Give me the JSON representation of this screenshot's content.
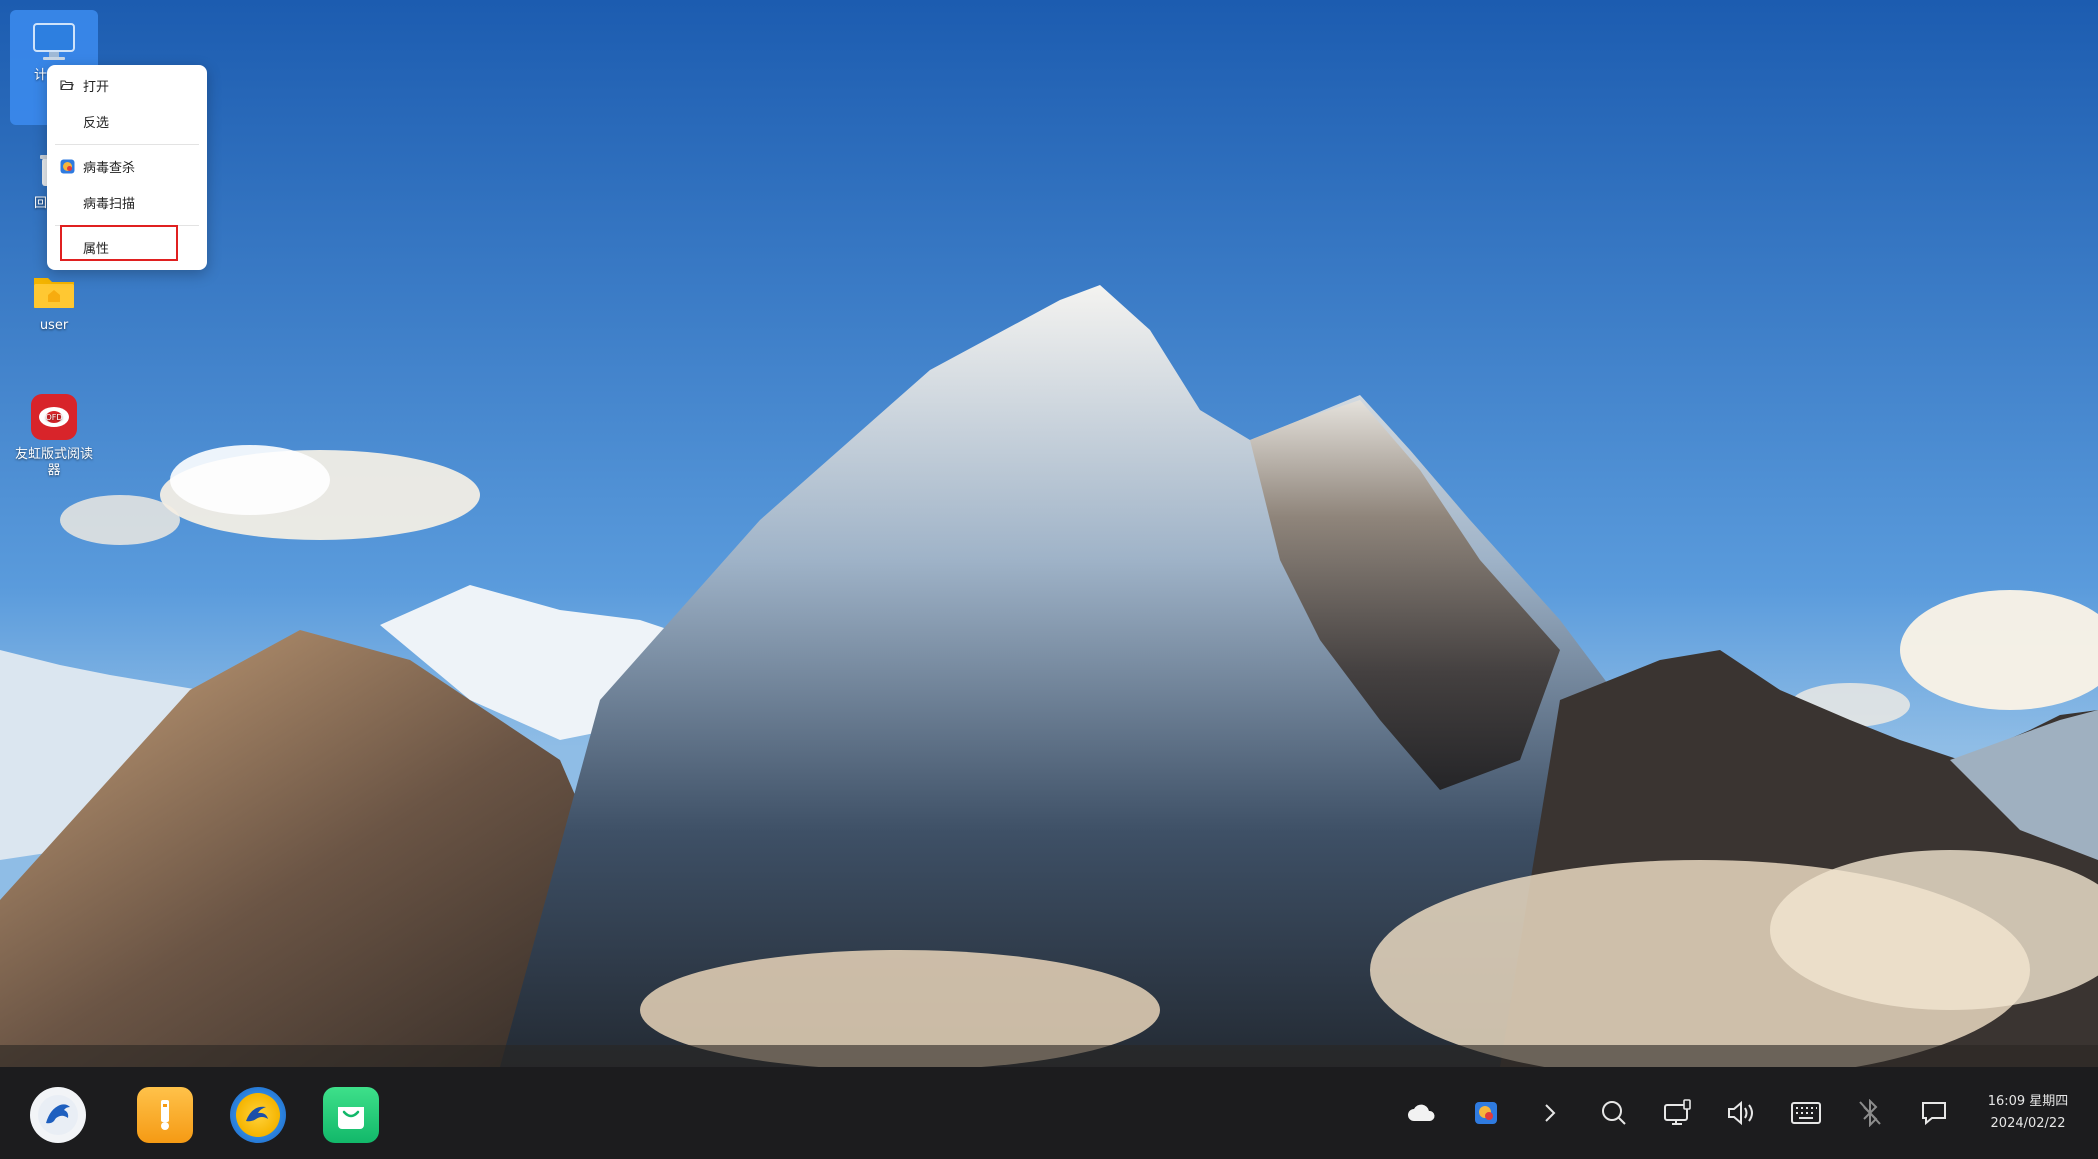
{
  "desktop": {
    "icons": [
      {
        "label": "计",
        "icon": "computer-icon"
      },
      {
        "label": "回",
        "icon": "recycle-bin-icon"
      },
      {
        "label": "user",
        "icon": "home-folder-icon"
      },
      {
        "label": "友虹版式阅读器",
        "icon": "ofd-reader-icon"
      }
    ]
  },
  "context_menu": {
    "items": [
      {
        "label": "打开",
        "icon": "folder-open-icon"
      },
      {
        "label": "反选",
        "icon": ""
      },
      {
        "label": "病毒查杀",
        "icon": "antivirus-icon"
      },
      {
        "label": "病毒扫描",
        "icon": ""
      },
      {
        "label": "属性",
        "icon": ""
      }
    ],
    "highlight_color": "#e02020"
  },
  "taskbar": {
    "apps": [
      {
        "name": "start-menu",
        "icon": "kylin-logo-icon"
      },
      {
        "name": "file-transfer",
        "icon": "usb-app-icon"
      },
      {
        "name": "browser",
        "icon": "browser-icon"
      },
      {
        "name": "app-store",
        "icon": "app-store-icon"
      }
    ],
    "tray": [
      "cloud-icon",
      "security-center-icon",
      "chevron-right-icon",
      "search-icon",
      "network-icon",
      "volume-icon",
      "keyboard-icon",
      "bluetooth-icon",
      "notification-icon"
    ],
    "clock": {
      "time_day": "16:09 星期四",
      "date": "2024/02/22"
    }
  }
}
